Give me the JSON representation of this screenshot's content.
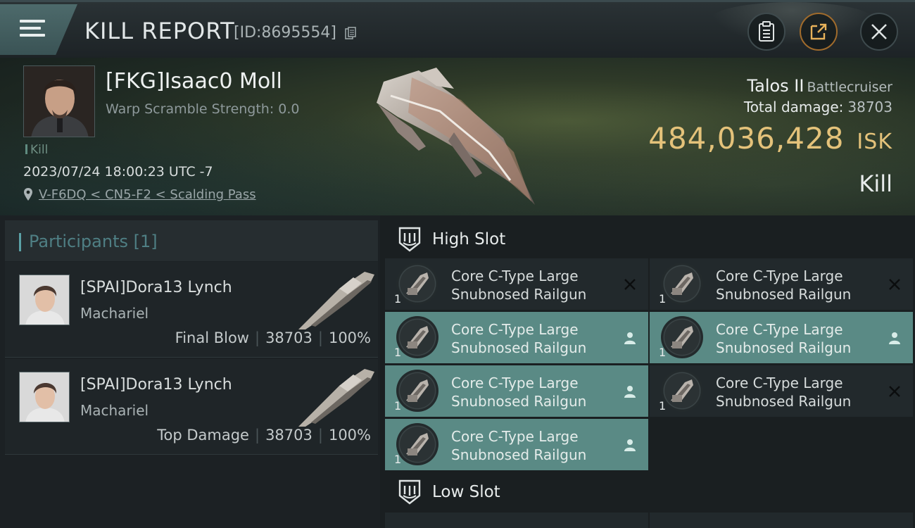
{
  "window": {
    "title": "KILL REPORT",
    "report_id": "[ID:8695554]",
    "icons": [
      "menu-icon",
      "copy-icon",
      "clipboard-icon",
      "share-icon",
      "close-icon"
    ]
  },
  "victim": {
    "name": "[FKG]Isaac0 Moll",
    "warp_scramble": "Warp Scramble Strength: 0.0",
    "tag": "Kill",
    "datetime": "2023/07/24 18:00:23 UTC -7",
    "location": "V-F6DQ < CN5-F2 < Scalding Pass"
  },
  "ship": {
    "name": "Talos II",
    "class": "Battlecruiser",
    "total_damage_label": "Total damage:",
    "total_damage": "38703",
    "value": "484,036,428",
    "currency": "ISK",
    "result": "Kill"
  },
  "participants": {
    "header": "Participants [1]",
    "items": [
      {
        "name": "[SPAI]Dora13 Lynch",
        "ship": "Machariel",
        "role": "Final Blow",
        "damage": "38703",
        "percent": "100%"
      },
      {
        "name": "[SPAI]Dora13 Lynch",
        "ship": "Machariel",
        "role": "Top Damage",
        "damage": "38703",
        "percent": "100%"
      }
    ]
  },
  "slots": {
    "high": {
      "label": "High Slot",
      "modules": [
        {
          "name_line1": "Core C-Type Large",
          "name_line2": "Snubnosed Railgun",
          "qty": "1",
          "state": "destroyed"
        },
        {
          "name_line1": "Core C-Type Large",
          "name_line2": "Snubnosed Railgun",
          "qty": "1",
          "state": "destroyed"
        },
        {
          "name_line1": "Core C-Type Large",
          "name_line2": "Snubnosed Railgun",
          "qty": "1",
          "state": "dropped"
        },
        {
          "name_line1": "Core C-Type Large",
          "name_line2": "Snubnosed Railgun",
          "qty": "1",
          "state": "dropped"
        },
        {
          "name_line1": "Core C-Type Large",
          "name_line2": "Snubnosed Railgun",
          "qty": "1",
          "state": "dropped"
        },
        {
          "name_line1": "Core C-Type Large",
          "name_line2": "Snubnosed Railgun",
          "qty": "1",
          "state": "destroyed"
        },
        {
          "name_line1": "Core C-Type Large",
          "name_line2": "Snubnosed Railgun",
          "qty": "1",
          "state": "dropped"
        }
      ]
    },
    "low": {
      "label": "Low Slot"
    }
  },
  "colors": {
    "accent_teal": "#5a8a85",
    "isk_gold": "#e4c27a",
    "participants_header": "#4f7f84"
  }
}
